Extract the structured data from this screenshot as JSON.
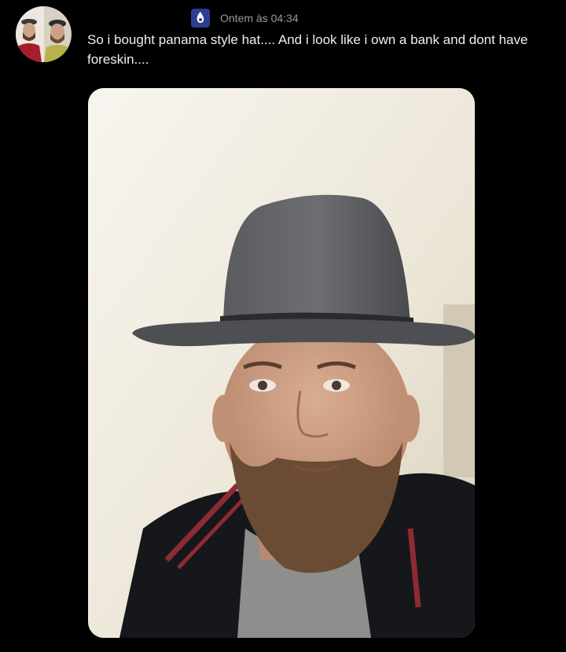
{
  "message": {
    "timestamp": "Ontem às 04:34",
    "content": "So i bought panama style hat.... And i look like i own a bank and dont have foreskin....",
    "avatar_icon": "user-avatar",
    "role_icon": "role-badge-icon",
    "attachment_icon": "photo-attachment"
  },
  "colors": {
    "background": "#000000",
    "text": "#eeeff1",
    "timestamp": "#949ba4"
  }
}
